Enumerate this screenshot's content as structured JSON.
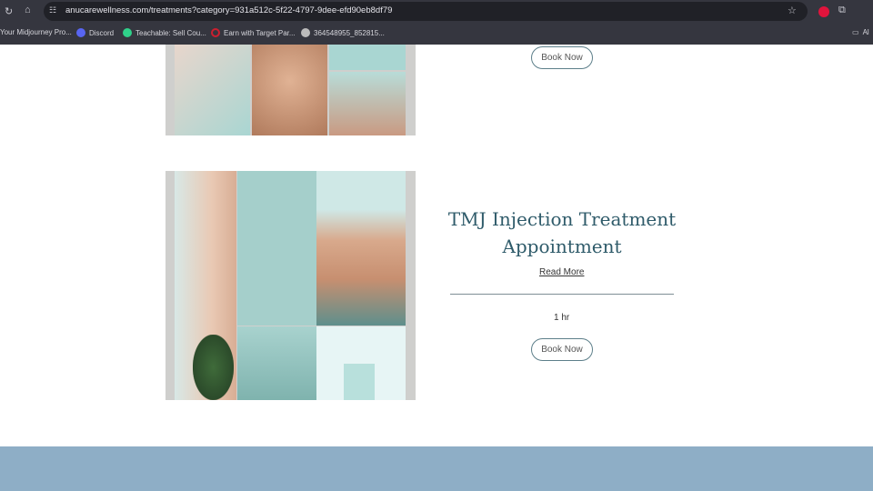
{
  "browser": {
    "url": "anucarewellness.com/treatments?category=931a512c-5f22-4797-9dee-efd90eb8df79",
    "bookmarks": [
      {
        "label": "Your Midjourney Pro...",
        "icon": "none"
      },
      {
        "label": "Discord",
        "icon": "discord-icon",
        "color": "#5865f2"
      },
      {
        "label": "Teachable: Sell Cou...",
        "icon": "teachable-icon",
        "color": "#2fd18a"
      },
      {
        "label": "Earn with Target Par...",
        "icon": "target-icon",
        "color": "#cc1f2f"
      },
      {
        "label": "364548955_852815...",
        "icon": "globe-icon",
        "color": "#bbbbbb"
      }
    ],
    "all_bookmarks": "Al"
  },
  "treatments": [
    {
      "book_label": "Book Now"
    },
    {
      "title": "TMJ Injection Treatment Appointment",
      "read_more": "Read More",
      "duration": "1 hr",
      "book_label": "Book Now"
    }
  ],
  "colors": {
    "title": "#2f5b6a",
    "footer": "#8eaec6",
    "image_mint": "#a9d6d2"
  }
}
